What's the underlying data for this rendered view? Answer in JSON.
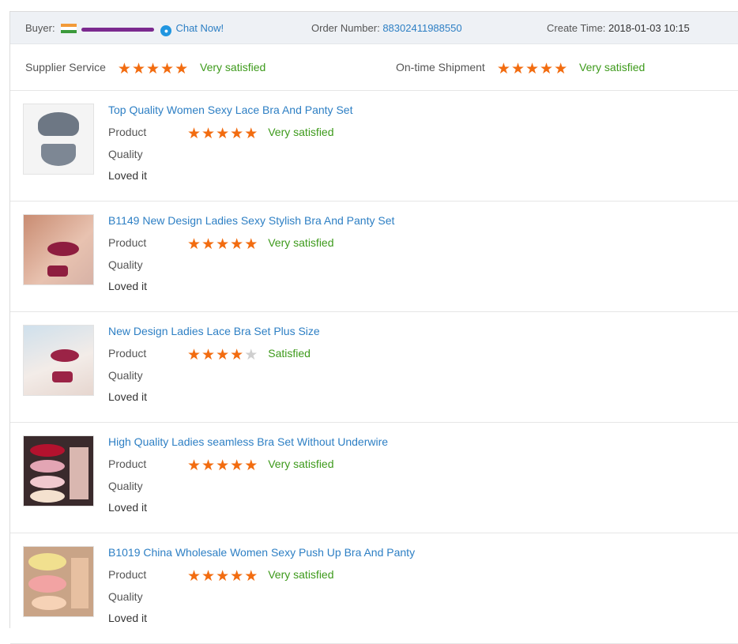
{
  "header": {
    "buyer_label": "Buyer:",
    "chat_label": "Chat Now!",
    "order_label": "Order Number:",
    "order_number": "88302411988550",
    "create_label": "Create Time:",
    "create_time": "2018-01-03 10:15"
  },
  "overall": {
    "supplier_service": {
      "label": "Supplier Service",
      "stars": 5,
      "text": "Very satisfied"
    },
    "on_time_shipment": {
      "label": "On-time Shipment",
      "stars": 5,
      "text": "Very satisfied"
    }
  },
  "labels": {
    "product": "Product",
    "quality": "Quality"
  },
  "products": [
    {
      "title": "Top Quality Women Sexy Lace Bra And Panty Set",
      "stars": 5,
      "rating_text": "Very satisfied",
      "comment": "Loved it"
    },
    {
      "title": "B1149 New Design Ladies Sexy Stylish Bra And Panty Set",
      "stars": 5,
      "rating_text": "Very satisfied",
      "comment": "Loved it"
    },
    {
      "title": "New Design Ladies Lace Bra Set Plus Size",
      "stars": 4,
      "rating_text": "Satisfied",
      "comment": "Loved it"
    },
    {
      "title": "High Quality Ladies seamless Bra Set Without Underwire",
      "stars": 5,
      "rating_text": "Very satisfied",
      "comment": "Loved it"
    },
    {
      "title": "B1019 China Wholesale Women Sexy Push Up Bra And Panty",
      "stars": 5,
      "rating_text": "Very satisfied",
      "comment": "Loved it"
    }
  ],
  "colors": {
    "link": "#2d7fc4",
    "star": "#f26c10",
    "star_empty": "#cfcfcf",
    "positive": "#3d9a1b",
    "header_bg": "#eef1f5"
  }
}
